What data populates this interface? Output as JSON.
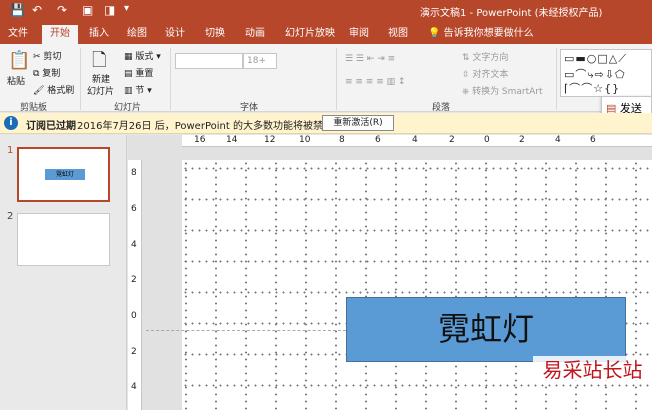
{
  "window": {
    "title": "演示文稿1 - PowerPoint (未经授权产品)"
  },
  "quick_access": {
    "save_icon": "save-icon",
    "undo_icon": "undo-icon",
    "redo_icon": "redo-icon",
    "present_icon": "start-from-beginning-icon",
    "window_icon": "window-layout-icon"
  },
  "tabs": [
    "文件",
    "开始",
    "插入",
    "绘图",
    "设计",
    "切换",
    "动画",
    "幻灯片放映",
    "审阅",
    "视图"
  ],
  "tell_me": "告诉我你想要做什么",
  "ribbon": {
    "clipboard": {
      "paste": "粘贴",
      "cut": "剪切",
      "copy": "复制",
      "format_painter": "格式刷",
      "label": "剪贴板"
    },
    "slides": {
      "new_slide": "新建",
      "new_slide_line2": "幻灯片",
      "layout": "版式",
      "reset": "重置",
      "section": "节",
      "label": "幻灯片"
    },
    "font": {
      "size": "18+",
      "label": "字体"
    },
    "paragraph": {
      "text_direction": "文字方向",
      "align_text": "对齐文本",
      "smartart": "转换为 SmartArt",
      "label": "段落"
    },
    "send": "发送"
  },
  "infobar": {
    "title": "订阅已过期",
    "message": "2016年7月26日 后，PowerPoint 的大多数功能将被禁用。",
    "button": "重新激活(R)"
  },
  "thumbnails": [
    {
      "num": "1",
      "text": "霓虹灯"
    },
    {
      "num": "2",
      "text": ""
    }
  ],
  "rulers": {
    "h": [
      "16",
      "14",
      "12",
      "10",
      "8",
      "6",
      "4",
      "2",
      "0",
      "2",
      "4",
      "6"
    ],
    "v": [
      "8",
      "6",
      "4",
      "2",
      "0",
      "2",
      "4"
    ]
  },
  "slide": {
    "textbox": "霓虹灯"
  },
  "watermark": "易采站长站",
  "colors": {
    "accent": "#b7472a",
    "shape_fill": "#5b9bd5",
    "info_bar": "#fff4ce"
  }
}
